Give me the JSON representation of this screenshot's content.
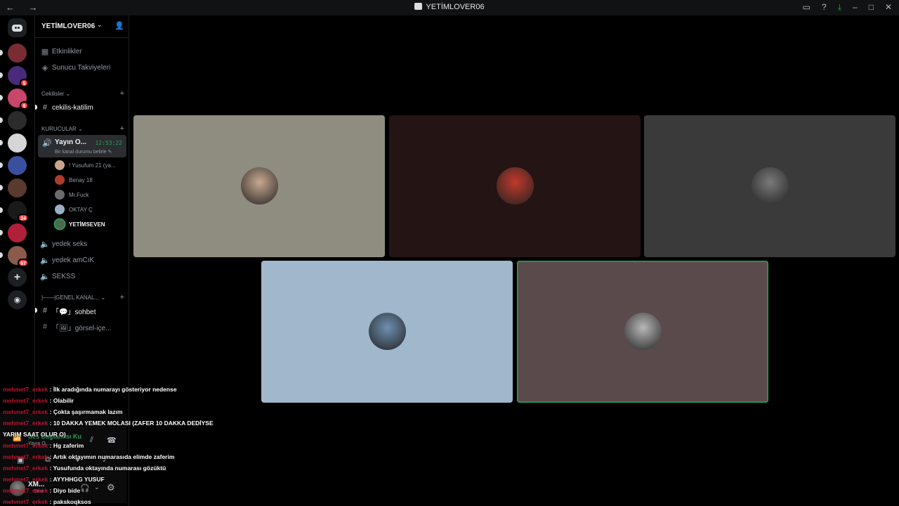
{
  "titlebar": {
    "title": "YETİMLOVER06",
    "nav": "← →"
  },
  "server": {
    "name": "YETİMLOVER06",
    "top_items": [
      {
        "icon": "calendar-icon",
        "label": "Etkinlikler"
      },
      {
        "icon": "boost-icon",
        "label": "Sunucu Takviyeleri"
      }
    ],
    "categories": {
      "cekilisler": "Cekilisler",
      "kurucular": "KURUCULAR",
      "genel": "|——|GENEL KANAL..."
    },
    "channels": {
      "cekilis": "cekilis-katilim",
      "sohbet": "「💬」sohbet",
      "gorsel": "「🖼」görsel-içe..."
    },
    "active_voice": {
      "name": "Yayın O...",
      "time": "12:53:22",
      "status": "Bir kanal durumu belirle"
    },
    "voice_users": [
      {
        "name": "! Yusufum 21 (ya...",
        "color": "#c9a48c",
        "speaking": false
      },
      {
        "name": "Benay 18",
        "color": "#b03a2e",
        "speaking": false
      },
      {
        "name": "Mr.Fuck",
        "color": "#6b6b6b",
        "speaking": false
      },
      {
        "name": "OKTAY Ç",
        "color": "#9ab0c8",
        "speaking": false
      },
      {
        "name": "YETİMSEVEN",
        "color": "#4a6b50",
        "speaking": true
      }
    ],
    "voice_channels": [
      "yedek seks",
      "yedek amCıK",
      "SEKSS"
    ]
  },
  "servers": [
    {
      "color": "#7a2c33",
      "badge": ""
    },
    {
      "color": "#4a2a7a",
      "badge": "5"
    },
    {
      "color": "#c9456a",
      "badge": "6"
    },
    {
      "color": "#2b2b2b",
      "badge": ""
    },
    {
      "color": "#d6d6d6",
      "badge": ""
    },
    {
      "color": "#3b4fa0",
      "badge": ""
    },
    {
      "color": "#5a3a2e",
      "badge": ""
    },
    {
      "color": "#1a1a1a",
      "badge": "24"
    },
    {
      "color": "#b0203a",
      "badge": ""
    },
    {
      "color": "#8a5a4a",
      "badge": "67"
    }
  ],
  "voice_panel": {
    "connection": "Ses Bağlantısı Ku",
    "channel": "Yayın O...",
    "user_name": "XM...",
    "user_status": "Sesi"
  },
  "tiles": [
    {
      "bg": "#8f8c80",
      "avatar": "#c8a890",
      "speaking": false
    },
    {
      "bg": "#241414",
      "avatar": "#c0392b",
      "speaking": false
    },
    {
      "bg": "#3a3a3a",
      "avatar": "#7a7a7a",
      "speaking": false
    },
    {
      "bg": "#a1b8cc",
      "avatar": "#6e8fb0",
      "speaking": false
    },
    {
      "bg": "#5b4a4c",
      "avatar": "#b8b8b8",
      "speaking": true
    }
  ],
  "chat": [
    {
      "user": "mehmet7_erkek",
      "text": ": İlk aradığında numarayı gösteriyor nedense"
    },
    {
      "user": "mehmet7_erkek",
      "text": ": Olabilir"
    },
    {
      "user": "mehmet7_erkek",
      "text": ": Çokta şaşırmamak lazım"
    },
    {
      "user": "mehmet7_erkek",
      "text": ": 10 DAKKA YEMEK MOLASI (ZAFER 10 DAKKA DEDİYSE YARIM SAAT OLUR O)"
    },
    {
      "user": "mehmet7_erkek",
      "text": ": Hg zaferim"
    },
    {
      "user": "mehmet7_erkek",
      "text": ": Artık oktayımın numarasıda elimde zaferim"
    },
    {
      "user": "mehmet7_erkek",
      "text": ": Yusufunda oktayında numarası gözüktü"
    },
    {
      "user": "mehmet7_erkek",
      "text": ": AYYHHGG YUSUF"
    },
    {
      "user": "mehmet7_erkek",
      "text": ": Diyo bide"
    },
    {
      "user": "mehmet7_erkek",
      "text": ": pakskoqksos"
    }
  ]
}
